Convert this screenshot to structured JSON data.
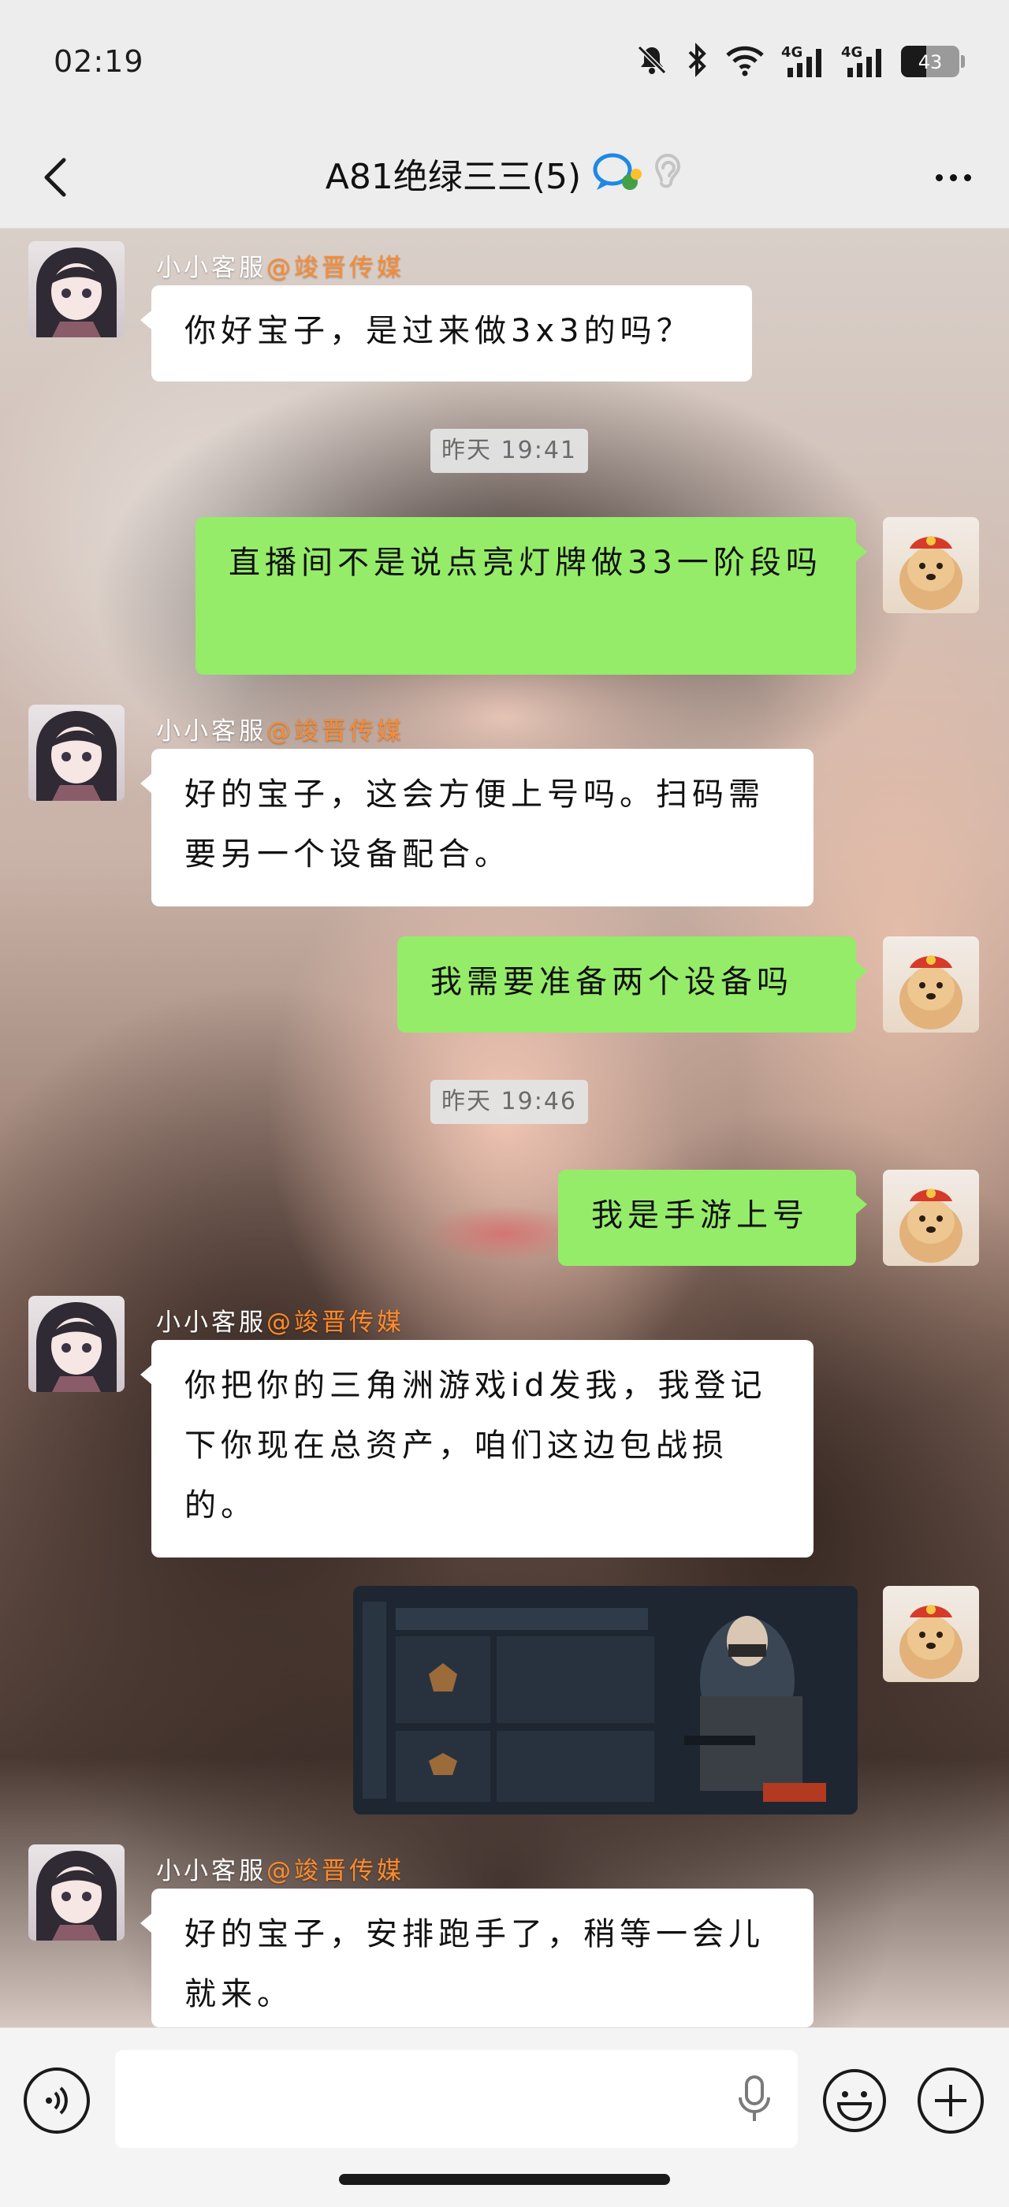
{
  "status_bar": {
    "time": "02:19",
    "network_1": "4G",
    "network_2": "4G",
    "battery": "43",
    "battery_fraction": 0.43
  },
  "header": {
    "title": "A81绝绿三三(5)"
  },
  "messages": [
    {
      "sender": "小小客服",
      "org": "@竣晋传媒",
      "text": "你好宝子，是过来做3x3的吗？"
    },
    {
      "timestamp": "昨天 19:41"
    },
    {
      "text": "直播间不是说点亮灯牌做33一阶段吗"
    },
    {
      "sender": "小小客服",
      "org": "@竣晋传媒",
      "text": "好的宝子，这会方便上号吗。扫码需要另一个设备配合。"
    },
    {
      "text": "我需要准备两个设备吗"
    },
    {
      "timestamp": "昨天 19:46"
    },
    {
      "text": "我是手游上号"
    },
    {
      "sender": "小小客服",
      "org": "@竣晋传媒",
      "text": "你把你的三角洲游戏id发我，我登记下你现在总资产，咱们这边包战损的。"
    },
    {
      "sender": "小小客服",
      "org": "@竣晋传媒",
      "text": "好的宝子，安排跑手了，稍等一会儿就来。"
    }
  ],
  "input": {
    "placeholder": ""
  },
  "icons": {
    "back": "chevron-left-icon",
    "more": "more-dots-icon",
    "voice": "voice-icon",
    "mic": "microphone-icon",
    "emoji": "emoji-icon",
    "plus": "plus-icon"
  },
  "colors": {
    "sent_bubble": "#95ec69",
    "received_bubble": "#ffffff",
    "org_tag": "#ff8a2a"
  }
}
